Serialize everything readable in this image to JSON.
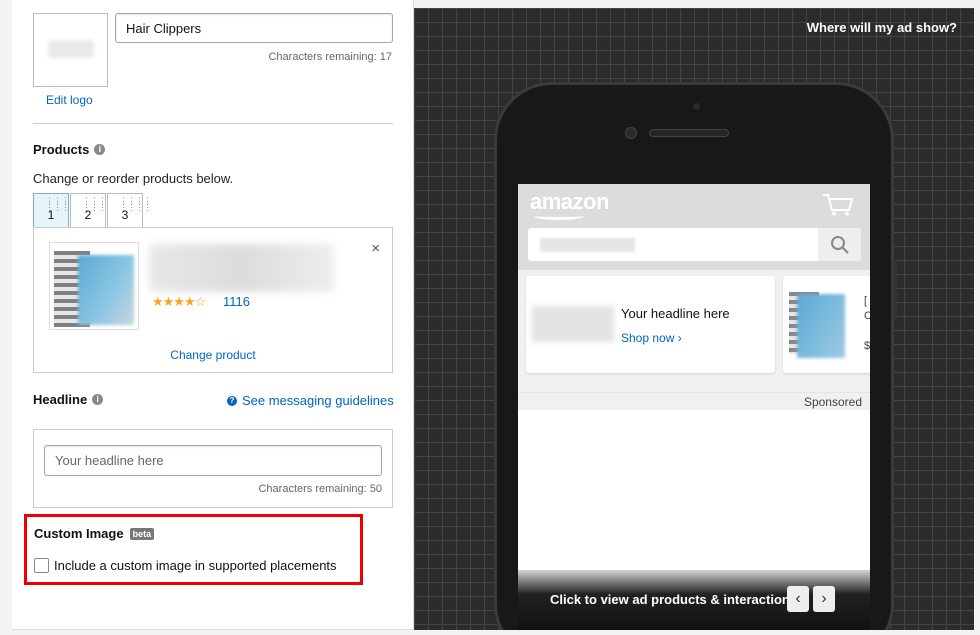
{
  "brand": {
    "name_value": "Hair Clippers",
    "chars_remaining": "Characters remaining: 17",
    "edit_logo": "Edit logo"
  },
  "products": {
    "title": "Products",
    "instruction": "Change or reorder products below.",
    "tabs": [
      {
        "label": "1"
      },
      {
        "label": "2"
      },
      {
        "label": "3"
      }
    ],
    "rating_count": "1116",
    "change_product": "Change product",
    "close_symbol": "×",
    "stars": "★★★★☆"
  },
  "headline": {
    "title": "Headline",
    "guidelines_link": "See messaging guidelines",
    "placeholder": "Your headline here",
    "chars_remaining": "Characters remaining: 50"
  },
  "custom_image": {
    "title": "Custom Image",
    "badge": "beta",
    "checkbox_label": "Include a custom image in supported placements"
  },
  "preview": {
    "where_show": "Where will my ad show?",
    "amazon_logo": "amazon",
    "ad_headline": "Your headline here",
    "shop_now": "Shop now ›",
    "sponsored": "Sponsored",
    "click_view": "Click to view ad products & interaction",
    "prev_symbol": "‹",
    "next_symbol": "›"
  },
  "icons": [
    "info-icon",
    "question-icon",
    "close-icon",
    "cart-icon",
    "search-icon",
    "chevron-left-icon",
    "chevron-right-icon"
  ],
  "colors": {
    "link": "#0066c0",
    "highlight": "#ee0000",
    "star": "#f5a623"
  }
}
